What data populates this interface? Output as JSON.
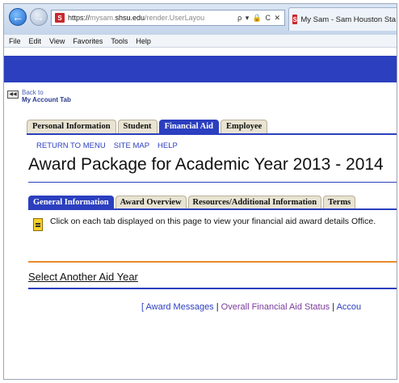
{
  "browser": {
    "url_proto": "https://",
    "url_host_pre": "mysam.",
    "url_host": "shsu.edu",
    "url_path": "/render.UserLayou",
    "address_tools": "ρ ▾ 🔒 C ✕",
    "tab_title": "My Sam - Sam Houston Sta...",
    "favicon_text": "S"
  },
  "menu": [
    "File",
    "Edit",
    "View",
    "Favorites",
    "Tools",
    "Help"
  ],
  "back": {
    "line1": "Back to",
    "line2": "My Account Tab"
  },
  "main_tabs": [
    {
      "label": "Personal Information",
      "active": false
    },
    {
      "label": "Student",
      "active": false
    },
    {
      "label": "Financial Aid",
      "active": true
    },
    {
      "label": "Employee",
      "active": false
    }
  ],
  "top_links": [
    "RETURN TO MENU",
    "SITE MAP",
    "HELP"
  ],
  "page_title": "Award Package for Academic Year 2013 - 2014",
  "sub_tabs": [
    {
      "label": "General Information",
      "active": true
    },
    {
      "label": "Award Overview",
      "active": false
    },
    {
      "label": "Resources/Additional Information",
      "active": false
    },
    {
      "label": "Terms",
      "active": false
    }
  ],
  "info_text": "Click on each tab displayed on this page to view your financial aid award details Office.",
  "select_year": "Select Another Aid Year",
  "footer": {
    "open": "[ ",
    "award_messages": "Award Messages",
    "sep": " | ",
    "overall_status": "Overall Financial Aid Status",
    "account": "Accou"
  },
  "colors": {
    "accent": "#2b3fbf",
    "orange": "#e88b2a"
  }
}
